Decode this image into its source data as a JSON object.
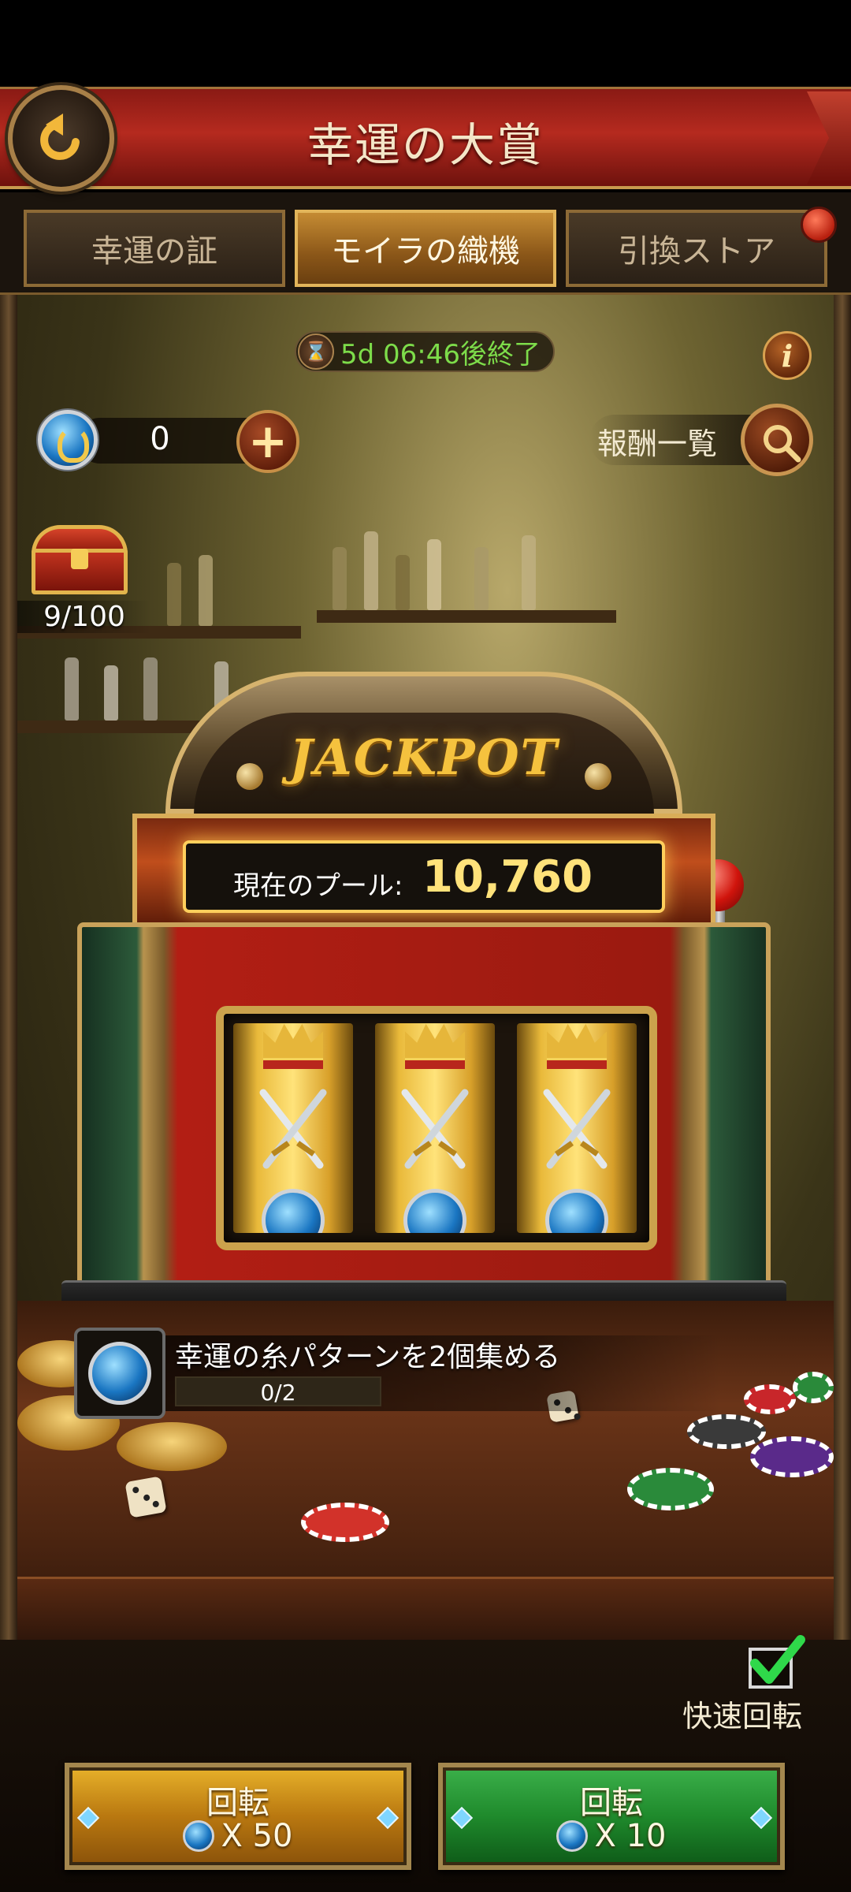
{
  "header": {
    "title": "幸運の大賞"
  },
  "tabs": [
    {
      "label": "幸運の証",
      "active": false
    },
    {
      "label": "モイラの織機",
      "active": true
    },
    {
      "label": "引換ストア",
      "active": false
    }
  ],
  "timer": {
    "text": "5d 06:46後終了"
  },
  "currency": {
    "value": "0"
  },
  "rewards": {
    "label": "報酬一覧"
  },
  "chest": {
    "progress": "9/100"
  },
  "machine": {
    "banner": "JACKPOT",
    "pool_label": "現在のプール:",
    "pool_value": "10,760"
  },
  "quest": {
    "text": "幸運の糸パターンを2個集める",
    "progress_text": "0/2",
    "progress_fraction": 0
  },
  "fast_spin": {
    "label": "快速回転",
    "checked": true
  },
  "spin_buttons": [
    {
      "label": "回転",
      "cost": "X 50",
      "color": "#c48d1a"
    },
    {
      "label": "回転",
      "cost": "X 10",
      "color": "#1f8a2c"
    }
  ],
  "colors": {
    "timer_text": "#7ddc4a",
    "pool_value": "#ffe27a",
    "header_red": "#b52a1f"
  }
}
